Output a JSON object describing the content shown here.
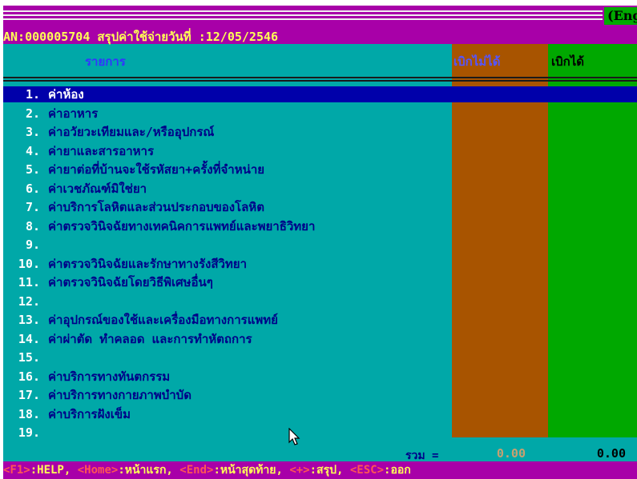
{
  "header": {
    "lang_label": "(Eng",
    "info_text": "AN:000005704  สรุปค่าใช้จ่ายวันที่ :12/05/2546"
  },
  "columns": {
    "items_label": "รายการ",
    "col1_label": "เบิกไม่ได้",
    "col2_label": "เบิกได้"
  },
  "items": [
    {
      "num": "1.",
      "label": "ค่าห้อง"
    },
    {
      "num": "2.",
      "label": "ค่าอาหาร"
    },
    {
      "num": "3.",
      "label": "ค่าอวัยวะเทียมและ/หรืออุปกรณ์"
    },
    {
      "num": "4.",
      "label": "ค่ายาและสารอาหาร"
    },
    {
      "num": "5.",
      "label": "ค่ายาต่อที่บ้านจะใช้รหัสยา+ครั้งที่จำหน่าย"
    },
    {
      "num": "6.",
      "label": "ค่าเวชภัณฑ์มิใช่ยา"
    },
    {
      "num": "7.",
      "label": "ค่าบริการโลหิตและส่วนประกอบของโลหิต"
    },
    {
      "num": "8.",
      "label": "ค่าตรวจวินิจฉัยทางเทคนิคการแพทย์และพยาธิวิทยา"
    },
    {
      "num": "9.",
      "label": ""
    },
    {
      "num": "10.",
      "label": "ค่าตรวจวินิจฉัยและรักษาทางรังสีวิทยา"
    },
    {
      "num": "11.",
      "label": "ค่าตรวจวินิจฉัยโดยวิธีพิเศษอื่นๆ"
    },
    {
      "num": "12.",
      "label": ""
    },
    {
      "num": "13.",
      "label": "ค่าอุปกรณ์ของใช้และเครื่องมือทางการแพทย์"
    },
    {
      "num": "14.",
      "label": "ค่าผ่าตัด ทำคลอด และการทำหัตถการ"
    },
    {
      "num": "15.",
      "label": ""
    },
    {
      "num": "16.",
      "label": "ค่าบริการทางทันตกรรม"
    },
    {
      "num": "17.",
      "label": "ค่าบริการทางกายภาพบำบัด"
    },
    {
      "num": "18.",
      "label": "ค่าบริการฝังเข็ม"
    },
    {
      "num": "19.",
      "label": ""
    }
  ],
  "selected_index": 0,
  "totals": {
    "label": "รวม =",
    "col1": "0.00",
    "col2": "0.00"
  },
  "footer": [
    {
      "key": "<F1>",
      "desc": ":HELP, "
    },
    {
      "key": "<Home>",
      "desc": ":หน้าแรก, "
    },
    {
      "key": "<End>",
      "desc": ":หน้าสุดท้าย, "
    },
    {
      "key": "<+>",
      "desc": ":สรุป, "
    },
    {
      "key": "<ESC>",
      "desc": ":ออก"
    }
  ],
  "colors": {
    "background": "#00a8a8",
    "header": "#a800a8",
    "col1": "#a85400",
    "col2": "#00a800",
    "selection": "#0000aa"
  }
}
